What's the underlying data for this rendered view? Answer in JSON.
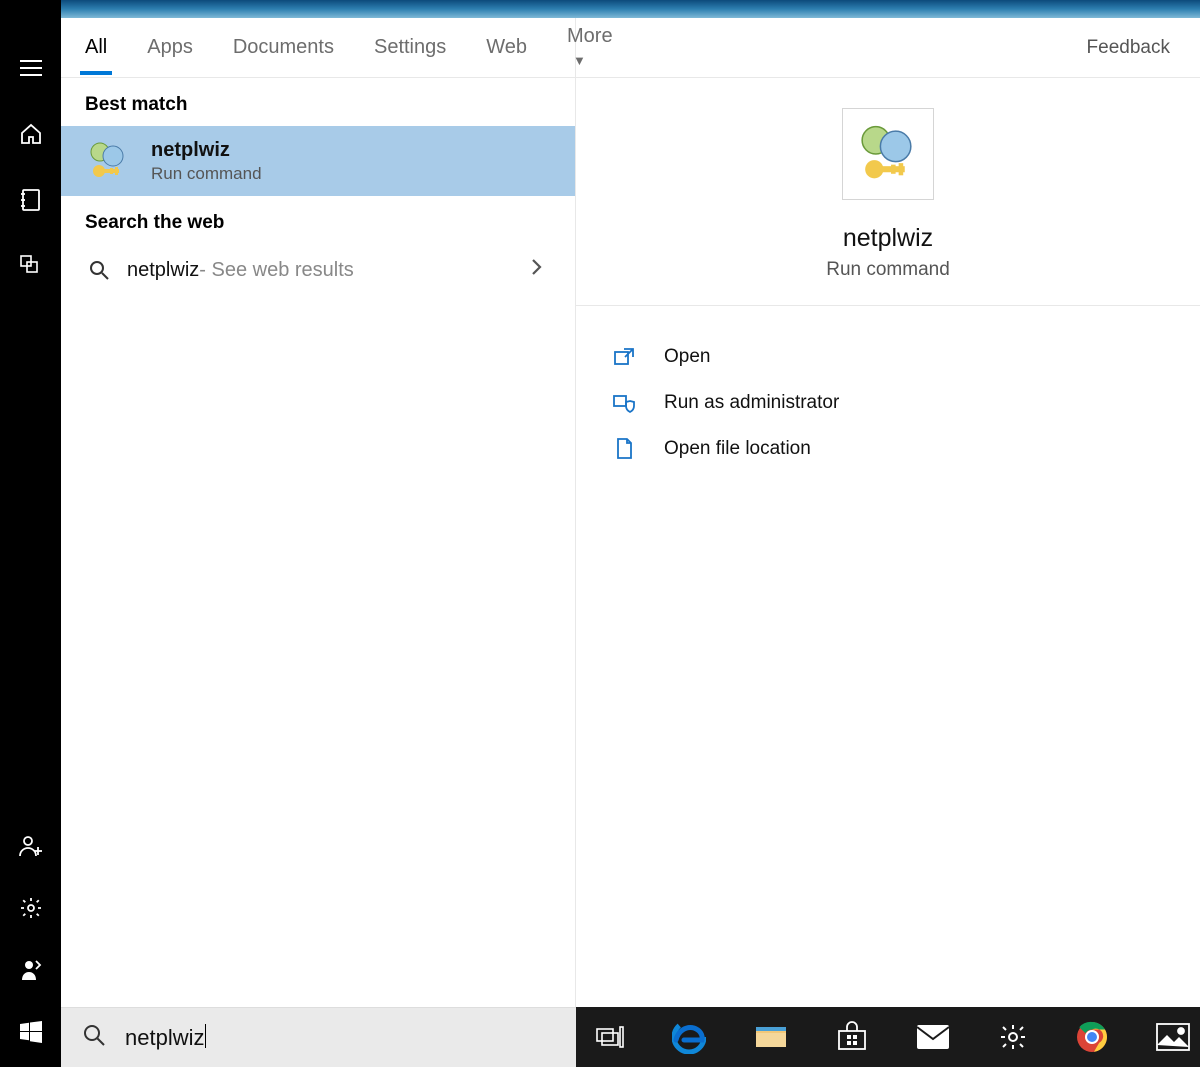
{
  "tabs": {
    "all": "All",
    "apps": "Apps",
    "documents": "Documents",
    "settings": "Settings",
    "web": "Web",
    "more": "More"
  },
  "feedback_label": "Feedback",
  "sections": {
    "best_match": "Best match",
    "search_web": "Search the web"
  },
  "best_match": {
    "title": "netplwiz",
    "subtitle": "Run command"
  },
  "web_result": {
    "query": "netplwiz",
    "suffix": " - See web results"
  },
  "preview": {
    "title": "netplwiz",
    "subtitle": "Run command"
  },
  "actions": {
    "open": "Open",
    "run_admin": "Run as administrator",
    "open_location": "Open file location"
  },
  "search": {
    "value": "netplwiz"
  }
}
